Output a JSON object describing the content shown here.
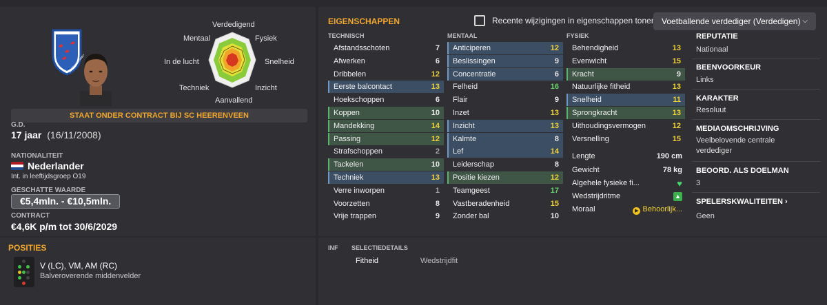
{
  "left": {
    "radar_labels": {
      "top": "Verdedigend",
      "top_left": "Mentaal",
      "top_right": "Fysiek",
      "left": "In de lucht",
      "right": "Snelheid",
      "bottom_left": "Techniek",
      "bottom_right": "Inzicht",
      "bottom": "Aanvallend"
    },
    "contract_banner": "STAAT ONDER CONTRACT BIJ SC HEERENVEEN",
    "dob_label": "G.D.",
    "age": "17 jaar",
    "dob": "(16/11/2008)",
    "nationality_label": "NATIONALITEIT",
    "nationality": "Nederlander",
    "youth_caps": "Int. in leeftijdsgroep O19",
    "value_label": "GESCHATTE WAARDE",
    "value": "€5,4mln. - €10,5mln.",
    "contract_label": "CONTRACT",
    "contract": "€4,6K p/m tot 30/6/2029",
    "crest_text": "sc Heerenveen"
  },
  "right": {
    "title": "EIGENSCHAPPEN",
    "show_changes_label": "Recente wijzigingen in eigenschappen tonen",
    "role_dropdown": "Voetballende verdediger (Verdedigen)",
    "col_technical": "TECHNISCH",
    "col_mental": "MENTAAL",
    "col_physical": "FYSIEK",
    "technical": [
      {
        "name": "Afstandsschoten",
        "value": "7",
        "c": "c-white",
        "hl": ""
      },
      {
        "name": "Afwerken",
        "value": "6",
        "c": "c-white",
        "hl": ""
      },
      {
        "name": "Dribbelen",
        "value": "12",
        "c": "c-yellow",
        "hl": ""
      },
      {
        "name": "Eerste balcontact",
        "value": "13",
        "c": "c-yellow",
        "hl": "hl-blue"
      },
      {
        "name": "Hoekschoppen",
        "value": "6",
        "c": "c-white",
        "hl": ""
      },
      {
        "name": "Koppen",
        "value": "10",
        "c": "c-white",
        "hl": "hl-green"
      },
      {
        "name": "Mandekking",
        "value": "14",
        "c": "c-yellow",
        "hl": "hl-green"
      },
      {
        "name": "Passing",
        "value": "12",
        "c": "c-yellow",
        "hl": "hl-green"
      },
      {
        "name": "Strafschoppen",
        "value": "2",
        "c": "c-gray",
        "hl": ""
      },
      {
        "name": "Tackelen",
        "value": "10",
        "c": "c-white",
        "hl": "hl-green"
      },
      {
        "name": "Techniek",
        "value": "13",
        "c": "c-yellow",
        "hl": "hl-blue"
      },
      {
        "name": "Verre inworpen",
        "value": "1",
        "c": "c-gray",
        "hl": ""
      },
      {
        "name": "Voorzetten",
        "value": "8",
        "c": "c-white",
        "hl": ""
      },
      {
        "name": "Vrije trappen",
        "value": "9",
        "c": "c-white",
        "hl": ""
      }
    ],
    "mental": [
      {
        "name": "Anticiperen",
        "value": "12",
        "c": "c-yellow",
        "hl": "hl-blue"
      },
      {
        "name": "Beslissingen",
        "value": "9",
        "c": "c-white",
        "hl": "hl-blue"
      },
      {
        "name": "Concentratie",
        "value": "6",
        "c": "c-white",
        "hl": "hl-blue"
      },
      {
        "name": "Felheid",
        "value": "16",
        "c": "c-green",
        "hl": ""
      },
      {
        "name": "Flair",
        "value": "9",
        "c": "c-white",
        "hl": ""
      },
      {
        "name": "Inzet",
        "value": "13",
        "c": "c-yellow",
        "hl": ""
      },
      {
        "name": "Inzicht",
        "value": "13",
        "c": "c-yellow",
        "hl": "hl-blue"
      },
      {
        "name": "Kalmte",
        "value": "8",
        "c": "c-white",
        "hl": "hl-blue"
      },
      {
        "name": "Lef",
        "value": "14",
        "c": "c-yellow",
        "hl": "hl-blue"
      },
      {
        "name": "Leiderschap",
        "value": "8",
        "c": "c-white",
        "hl": ""
      },
      {
        "name": "Positie kiezen",
        "value": "12",
        "c": "c-yellow",
        "hl": "hl-green"
      },
      {
        "name": "Teamgeest",
        "value": "17",
        "c": "c-green",
        "hl": ""
      },
      {
        "name": "Vastberadenheid",
        "value": "15",
        "c": "c-yellow",
        "hl": ""
      },
      {
        "name": "Zonder bal",
        "value": "10",
        "c": "c-white",
        "hl": ""
      }
    ],
    "physical": [
      {
        "name": "Behendigheid",
        "value": "13",
        "c": "c-yellow",
        "hl": ""
      },
      {
        "name": "Evenwicht",
        "value": "15",
        "c": "c-yellow",
        "hl": ""
      },
      {
        "name": "Kracht",
        "value": "9",
        "c": "c-white",
        "hl": "hl-green"
      },
      {
        "name": "Natuurlijke fitheid",
        "value": "13",
        "c": "c-yellow",
        "hl": ""
      },
      {
        "name": "Snelheid",
        "value": "11",
        "c": "c-yellow",
        "hl": "hl-blue"
      },
      {
        "name": "Sprongkracht",
        "value": "13",
        "c": "c-yellow",
        "hl": "hl-green"
      },
      {
        "name": "Uithoudingsvermogen",
        "value": "12",
        "c": "c-yellow",
        "hl": ""
      },
      {
        "name": "Versnelling",
        "value": "15",
        "c": "c-yellow",
        "hl": ""
      }
    ],
    "length_label": "Lengte",
    "length": "190 cm",
    "weight_label": "Gewicht",
    "weight": "78 kg",
    "fitness_label": "Algehele fysieke fi...",
    "rhythm_label": "Wedstrijdritme",
    "morale_label": "Moraal",
    "morale": "Behoorlijk...",
    "info": {
      "reputation_h": "REPUTATIE",
      "reputation": "Nationaal",
      "foot_h": "BEENVOORKEUR",
      "foot": "Links",
      "character_h": "KARAKTER",
      "character": "Resoluut",
      "media_h": "MEDIAOMSCHRIJVING",
      "media": "Veelbelovende centrale verdediger",
      "gk_h": "BEOORD. ALS DOELMAN",
      "gk": "3",
      "traits_h": "SPELERSKWALITEITEN",
      "traits": "Geen"
    }
  },
  "positions": {
    "title": "POSITIES",
    "main": "V (LC), VM, AM (RC)",
    "role": "Balveroverende middenvelder"
  },
  "selection": {
    "inf_h": "INF",
    "details_h": "SELECTIEDETAILS",
    "fitness_label": "Fitheid",
    "fitness_value": "Wedstrijdfit"
  },
  "colors": {
    "accent": "#f2a72e",
    "green_hl": "#3f5546",
    "blue_hl": "#3c4e63"
  }
}
